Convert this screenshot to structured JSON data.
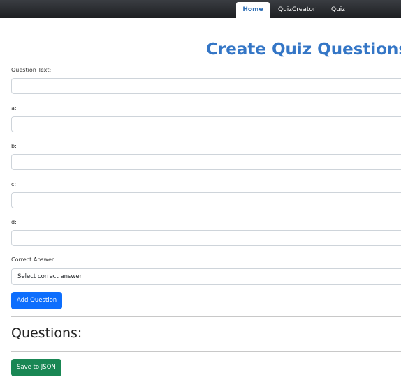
{
  "nav": {
    "tabs": [
      {
        "label": "Home",
        "active": true
      },
      {
        "label": "QuizCreator"
      },
      {
        "label": "Quiz"
      }
    ]
  },
  "page_title": "Create Quiz Questions",
  "form": {
    "question_label": "Question Text:",
    "a_label": "a:",
    "b_label": "b:",
    "c_label": "c:",
    "d_label": "d:",
    "correct_label": "Correct Answer:",
    "correct_select_value": "Select correct answer",
    "add_button": "Add Question"
  },
  "questions_heading": "Questions:",
  "save_button": "Save to JSON",
  "colors": {
    "primary": "#0d6efd",
    "success": "#198754",
    "title": "#3476c6"
  }
}
